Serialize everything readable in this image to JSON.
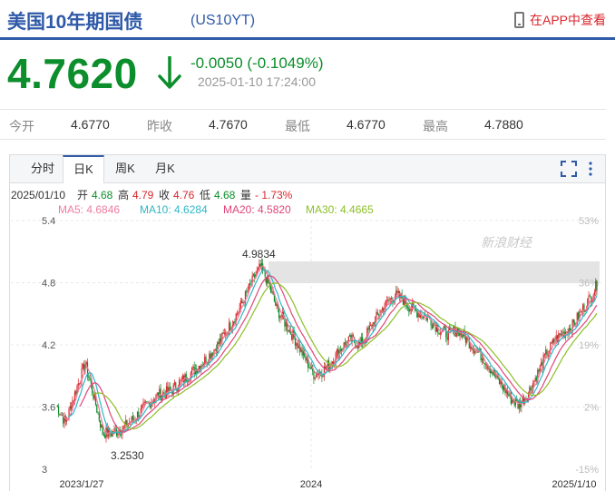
{
  "header": {
    "title": "美国10年期国债",
    "code": "(US10YT)",
    "app_link": "在APP中查看"
  },
  "quote": {
    "price": "4.7620",
    "change": "-0.0050 (-0.1049%)",
    "time": "2025-01-10 17:24:00"
  },
  "stats": [
    {
      "label": "今开",
      "value": "4.6770"
    },
    {
      "label": "昨收",
      "value": "4.7670"
    },
    {
      "label": "最低",
      "value": "4.6770"
    },
    {
      "label": "最高",
      "value": "4.7880"
    }
  ],
  "tabs": [
    "分时",
    "日K",
    "周K",
    "月K"
  ],
  "active_tab": "日K",
  "ohlc": {
    "date": "2025/01/10",
    "open_label": "开",
    "open": "4.68",
    "high_label": "高",
    "high": "4.79",
    "close_label": "收",
    "close": "4.76",
    "low_label": "低",
    "low": "4.68",
    "vol_label": "量",
    "pct": "- 1.73%"
  },
  "ma": [
    {
      "label": "MA5: 4.6846",
      "color": "#f07ca0"
    },
    {
      "label": "MA10: 4.6284",
      "color": "#2eb8c8"
    },
    {
      "label": "MA20: 4.5820",
      "color": "#e0457a"
    },
    {
      "label": "MA30: 4.4665",
      "color": "#8cbf26"
    }
  ],
  "watermark": "新浪财经",
  "chart_data": {
    "type": "candlestick",
    "y_ticks": [
      "5.4",
      "4.8",
      "4.2",
      "3.6",
      "3"
    ],
    "pct_ticks": [
      "53%",
      "36%",
      "19%",
      "2%",
      "-15%"
    ],
    "x_ticks": [
      "2023/1/27",
      "2024",
      "2025/1/10"
    ],
    "annotations": [
      {
        "text": "4.9834",
        "label": "high"
      },
      {
        "text": "3.2530",
        "label": "low"
      }
    ],
    "ylim": [
      3,
      5.4
    ],
    "close_points": [
      [
        0,
        3.62
      ],
      [
        8,
        3.45
      ],
      [
        18,
        3.8
      ],
      [
        25,
        4.02
      ],
      [
        32,
        3.72
      ],
      [
        40,
        3.35
      ],
      [
        48,
        3.35
      ],
      [
        58,
        3.4
      ],
      [
        68,
        3.5
      ],
      [
        78,
        3.62
      ],
      [
        88,
        3.72
      ],
      [
        98,
        3.75
      ],
      [
        108,
        3.85
      ],
      [
        118,
        3.95
      ],
      [
        128,
        4.05
      ],
      [
        138,
        4.18
      ],
      [
        148,
        4.35
      ],
      [
        158,
        4.55
      ],
      [
        165,
        4.72
      ],
      [
        172,
        4.88
      ],
      [
        176,
        4.95
      ],
      [
        182,
        4.82
      ],
      [
        190,
        4.55
      ],
      [
        198,
        4.4
      ],
      [
        206,
        4.25
      ],
      [
        214,
        4.08
      ],
      [
        222,
        3.92
      ],
      [
        230,
        3.95
      ],
      [
        238,
        4.05
      ],
      [
        246,
        4.18
      ],
      [
        254,
        4.25
      ],
      [
        262,
        4.2
      ],
      [
        270,
        4.35
      ],
      [
        278,
        4.5
      ],
      [
        286,
        4.62
      ],
      [
        292,
        4.68
      ],
      [
        298,
        4.65
      ],
      [
        306,
        4.55
      ],
      [
        314,
        4.5
      ],
      [
        322,
        4.45
      ],
      [
        330,
        4.35
      ],
      [
        338,
        4.3
      ],
      [
        346,
        4.35
      ],
      [
        354,
        4.25
      ],
      [
        362,
        4.15
      ],
      [
        370,
        4.05
      ],
      [
        378,
        3.9
      ],
      [
        386,
        3.78
      ],
      [
        392,
        3.68
      ],
      [
        398,
        3.62
      ],
      [
        406,
        3.72
      ],
      [
        414,
        3.9
      ],
      [
        422,
        4.1
      ],
      [
        430,
        4.25
      ],
      [
        438,
        4.32
      ],
      [
        446,
        4.4
      ],
      [
        454,
        4.55
      ],
      [
        460,
        4.65
      ],
      [
        466,
        4.78
      ]
    ]
  }
}
